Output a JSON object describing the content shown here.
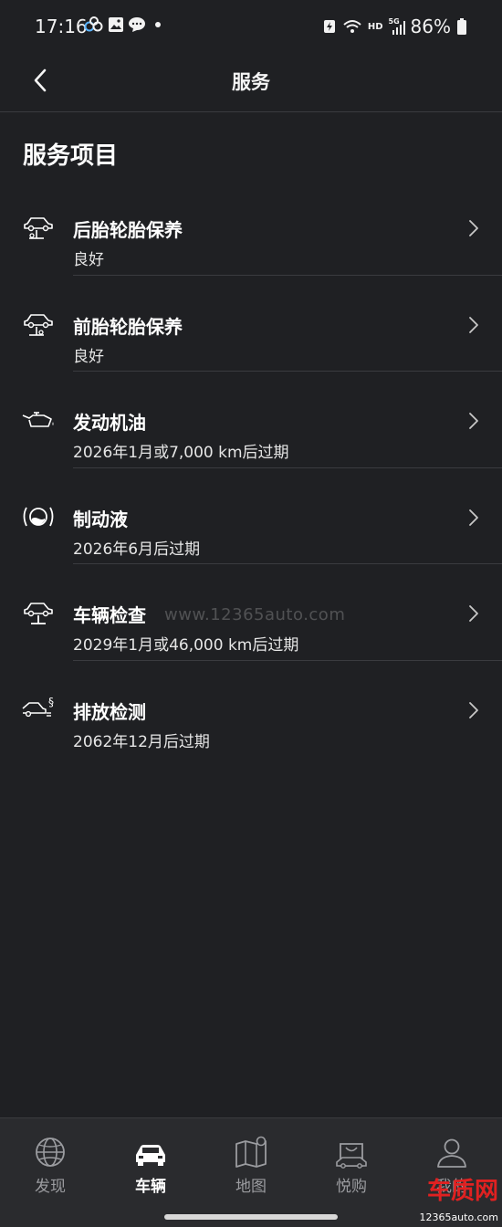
{
  "status_bar": {
    "time": "17:16",
    "battery": "86%",
    "network": "HD",
    "network_gen": "5G"
  },
  "header": {
    "title": "服务"
  },
  "section": {
    "title": "服务项目"
  },
  "services": [
    {
      "title": "后胎轮胎保养",
      "status": "良好",
      "icon": "car-lift-tire-icon"
    },
    {
      "title": "前胎轮胎保养",
      "status": "良好",
      "icon": "car-lift-tire-icon"
    },
    {
      "title": "发动机油",
      "status": "2026年1月或7,000 km后过期",
      "icon": "oil-can-icon"
    },
    {
      "title": "制动液",
      "status": "2026年6月后过期",
      "icon": "brake-fluid-icon"
    },
    {
      "title": "车辆检查",
      "status": "2029年1月或46,000 km后过期",
      "icon": "car-lift-icon"
    },
    {
      "title": "排放检测",
      "status": "2062年12月后过期",
      "icon": "exhaust-emission-icon"
    }
  ],
  "watermark": "www.12365auto.com",
  "bottom_nav": {
    "items": [
      {
        "label": "发现",
        "icon": "globe-icon",
        "active": false
      },
      {
        "label": "车辆",
        "icon": "car-icon",
        "active": true
      },
      {
        "label": "地图",
        "icon": "map-icon",
        "active": false
      },
      {
        "label": "悦购",
        "icon": "shopping-bag-icon",
        "active": false
      },
      {
        "label": "我的",
        "icon": "person-icon",
        "active": false
      }
    ]
  },
  "corner_logo": {
    "brand": "车质网",
    "url": "12365auto.com"
  },
  "colors": {
    "background": "#1f2023",
    "nav_background": "#2a2b2e",
    "divider": "#3a3b3f",
    "text_primary": "#ffffff",
    "text_muted": "#9b9ca0",
    "logo_red": "#e02121"
  }
}
